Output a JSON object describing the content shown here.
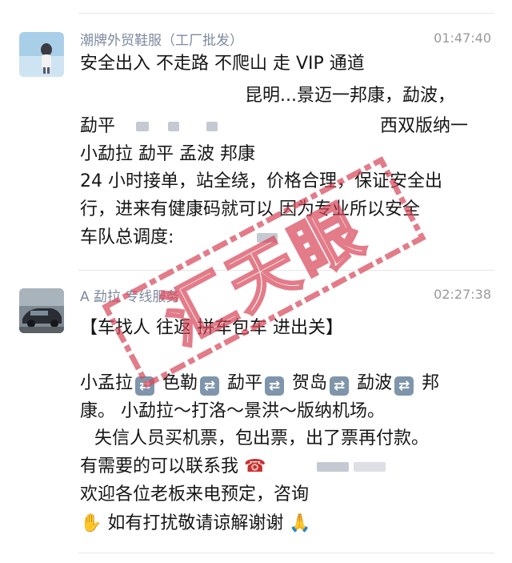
{
  "posts": [
    {
      "author": "潮牌外贸鞋服（工厂批发）",
      "time": "01:47:40",
      "lines": [
        "安全出入  不走路  不爬山  走 VIP 通道",
        "昆明...景迈一邦康，勐波，",
        "勐平",
        "西双版纳一",
        "小勐拉  勐平 孟波  邦康",
        "24 小时接单，站全绕，价格合理，保证安全出",
        "行，进来有健康码就可以  因为专业所以安全",
        "车队总调度:"
      ]
    },
    {
      "author": "A 勐拉  专线服务",
      "time": "02:27:38",
      "lines": [
        "【车找人 往返 拼车包车 进出关】",
        "小孟拉",
        "色勒",
        "勐平",
        "贺岛",
        "勐波",
        "邦",
        "康。     小勐拉～打洛～景洪～版纳机场。",
        "失信人员买机票，包出票，出了票再付款。",
        "有需要的可以联系我",
        "欢迎各位老板来电预定，咨询",
        "如有打扰敬请谅解谢谢"
      ]
    }
  ],
  "icons": {
    "repeat": "🔁",
    "telephone": "☎",
    "handshake": "🤝",
    "pray": "🙏"
  },
  "stamp": {
    "text": "汇天眼",
    "color": "#d9495c"
  },
  "colors": {
    "author": "#7e8aa0",
    "time": "#9a9a9a",
    "divider": "#e6e6e6",
    "text": "#161616"
  }
}
